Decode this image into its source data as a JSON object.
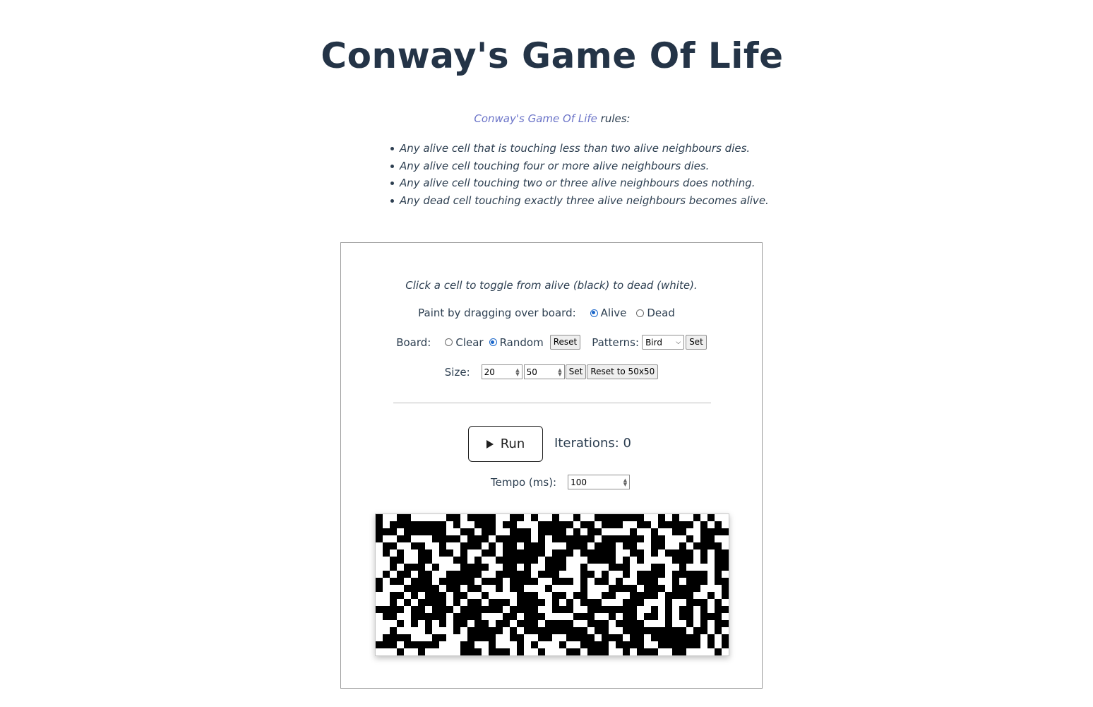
{
  "title": "Conway's Game Of Life",
  "rules": {
    "link_text": "Conway's Game Of Life",
    "suffix": " rules:",
    "items": [
      "Any alive cell that is touching less than two alive neighbours dies.",
      "Any alive cell touching four or more alive neighbours dies.",
      "Any alive cell touching two or three alive neighbours does nothing.",
      "Any dead cell touching exactly three alive neighbours becomes alive."
    ]
  },
  "panel": {
    "instruction": "Click a cell to toggle from alive (black) to dead (white).",
    "paint": {
      "label": "Paint by dragging over board:",
      "options": [
        "Alive",
        "Dead"
      ],
      "selected": "Alive"
    },
    "board": {
      "label": "Board:",
      "options": [
        "Clear",
        "Random"
      ],
      "selected": "Random",
      "reset_label": "Reset",
      "patterns_label": "Patterns:",
      "pattern_selected": "Bird",
      "set_label": "Set"
    },
    "size": {
      "label": "Size:",
      "rows": "20",
      "cols": "50",
      "set_label": "Set",
      "reset_label": "Reset to 50x50"
    },
    "run_label": "Run",
    "iterations_label": "Iterations: 0",
    "tempo_label": "Tempo (ms):",
    "tempo_value": "100"
  },
  "grid": {
    "rows": 20,
    "cols": 50,
    "cells": [
      "10011000001101111001101001001001111111001010010100",
      "10111111110100111011000111110110111001101111101010",
      "11101111110011011001110111101011000010010011001111",
      "10011000111101110111110101111110111111011000101100",
      "01100110010011101011011100011101110110011001011110",
      "01010011011010011011111101110111110011010111101011",
      "00110011000110100111111011100011110101000011101011",
      "00101110100011110011010011100100011100011001000011",
      "01011011001111100111110111000110100101111011111010",
      "10110111011111011101111001110101101001110010111011",
      "10001111101101100101100010000100011110111011110001",
      "00110101110110010000111001101100110011110111100101",
      "00101011110101101110111101010111000111000100111010",
      "11110110111011111101111001110011111110010101101011",
      "01100111110111100011011100001110010110110101101110",
      "00010101010110110110111011110011101111000100101011",
      "00100001000101111101011111111101100111111111011010",
      "01111000110001111001100110011110111011011111110101",
      "11101111100011001000101000100111101111001111110101",
      "00010010000011101110100100011011100101110011000010"
    ]
  }
}
